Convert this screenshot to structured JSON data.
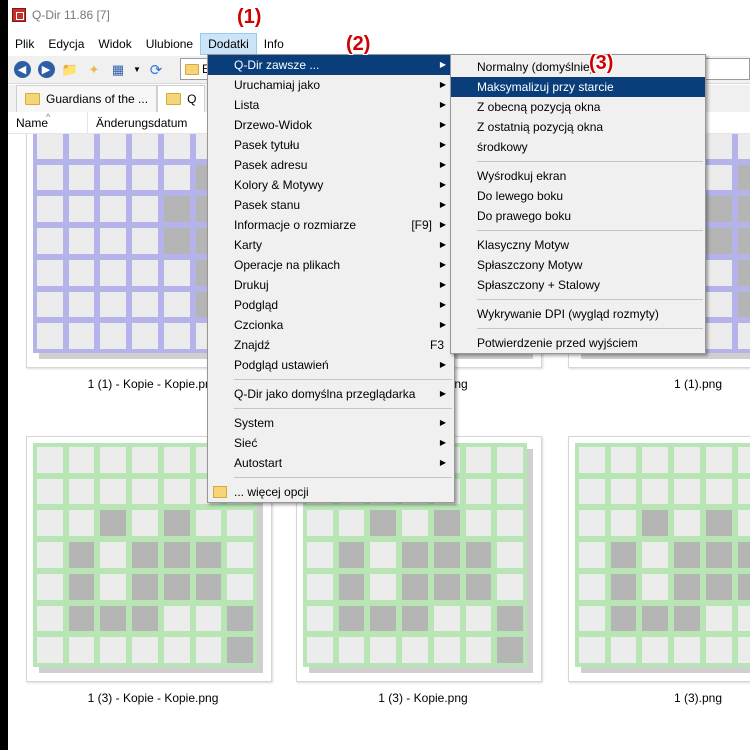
{
  "window": {
    "title": "Q-Dir 11.86 [7]"
  },
  "menubar": {
    "items": [
      "Plik",
      "Edycja",
      "Widok",
      "Ulubione",
      "Dodatki",
      "Info"
    ]
  },
  "address": {
    "value": "E:"
  },
  "tabs": [
    {
      "label": "Guardians of the ..."
    },
    {
      "label": "Q"
    }
  ],
  "columns": {
    "name": "Name",
    "date": "Änderungsdatum"
  },
  "colors": {
    "blue_board": "#b4b4ea",
    "green_board": "#b7e6b4",
    "menu_highlight": "#0a3e7a",
    "callout": "#d00000"
  },
  "files": [
    {
      "caption": "1 (1) - Kopie - Kopie.png",
      "color": "blue"
    },
    {
      "caption": "1 (1) - Kopie.png",
      "color": "blue"
    },
    {
      "caption": "1 (1).png",
      "color": "blue"
    },
    {
      "caption": "1 (3) - Kopie - Kopie.png",
      "color": "green"
    },
    {
      "caption": "1 (3) - Kopie.png",
      "color": "green"
    },
    {
      "caption": "1 (3).png",
      "color": "green"
    }
  ],
  "menu_dodatki": {
    "items": [
      {
        "label": "Q-Dir zawsze ...",
        "arrow": "▶"
      },
      {
        "label": "Uruchamiaj jako",
        "arrow": "▶"
      },
      {
        "label": "Lista",
        "arrow": "▶"
      },
      {
        "label": "Drzewo-Widok",
        "arrow": "▶"
      },
      {
        "label": "Pasek tytułu",
        "arrow": "▶"
      },
      {
        "label": "Pasek adresu",
        "arrow": "▶"
      },
      {
        "label": "Kolory & Motywy",
        "arrow": "▶"
      },
      {
        "label": "Pasek stanu",
        "arrow": "▶"
      },
      {
        "label": "Informacje o rozmiarze",
        "shortcut": "[F9]",
        "arrow": "▶"
      },
      {
        "label": "Karty",
        "arrow": "▶"
      },
      {
        "label": "Operacje na plikach",
        "arrow": "▶"
      },
      {
        "label": "Drukuj",
        "arrow": "▶"
      },
      {
        "label": "Podgląd",
        "arrow": "▶"
      },
      {
        "label": "Czcionka",
        "arrow": "▶"
      },
      {
        "label": "Znajdź",
        "shortcut": "F3"
      },
      {
        "label": "Podgląd ustawień",
        "arrow": "▶"
      },
      {
        "label": "Q-Dir jako domyślna przeglądarka",
        "arrow": "▶"
      },
      {
        "label": "System",
        "arrow": "▶"
      },
      {
        "label": "Sieć",
        "arrow": "▶"
      },
      {
        "label": "Autostart",
        "arrow": "▶"
      },
      {
        "label": "... więcej opcji"
      }
    ]
  },
  "submenu_zawsze": {
    "items": [
      "Normalny (domyślnie)",
      "Maksymalizuj przy starcie",
      "Z obecną pozycją okna",
      "Z ostatnią pozycją okna",
      "środkowy",
      "Wyśrodkuj ekran",
      "Do lewego boku",
      "Do prawego boku",
      "Klasyczny Motyw",
      "Spłaszczony Motyw",
      "Spłaszczony + Stalowy",
      "Wykrywanie DPI (wygląd rozmyty)",
      "Potwierdzenie przed wyjściem"
    ]
  },
  "callouts": [
    "(1)",
    "(2)",
    "(3)"
  ]
}
